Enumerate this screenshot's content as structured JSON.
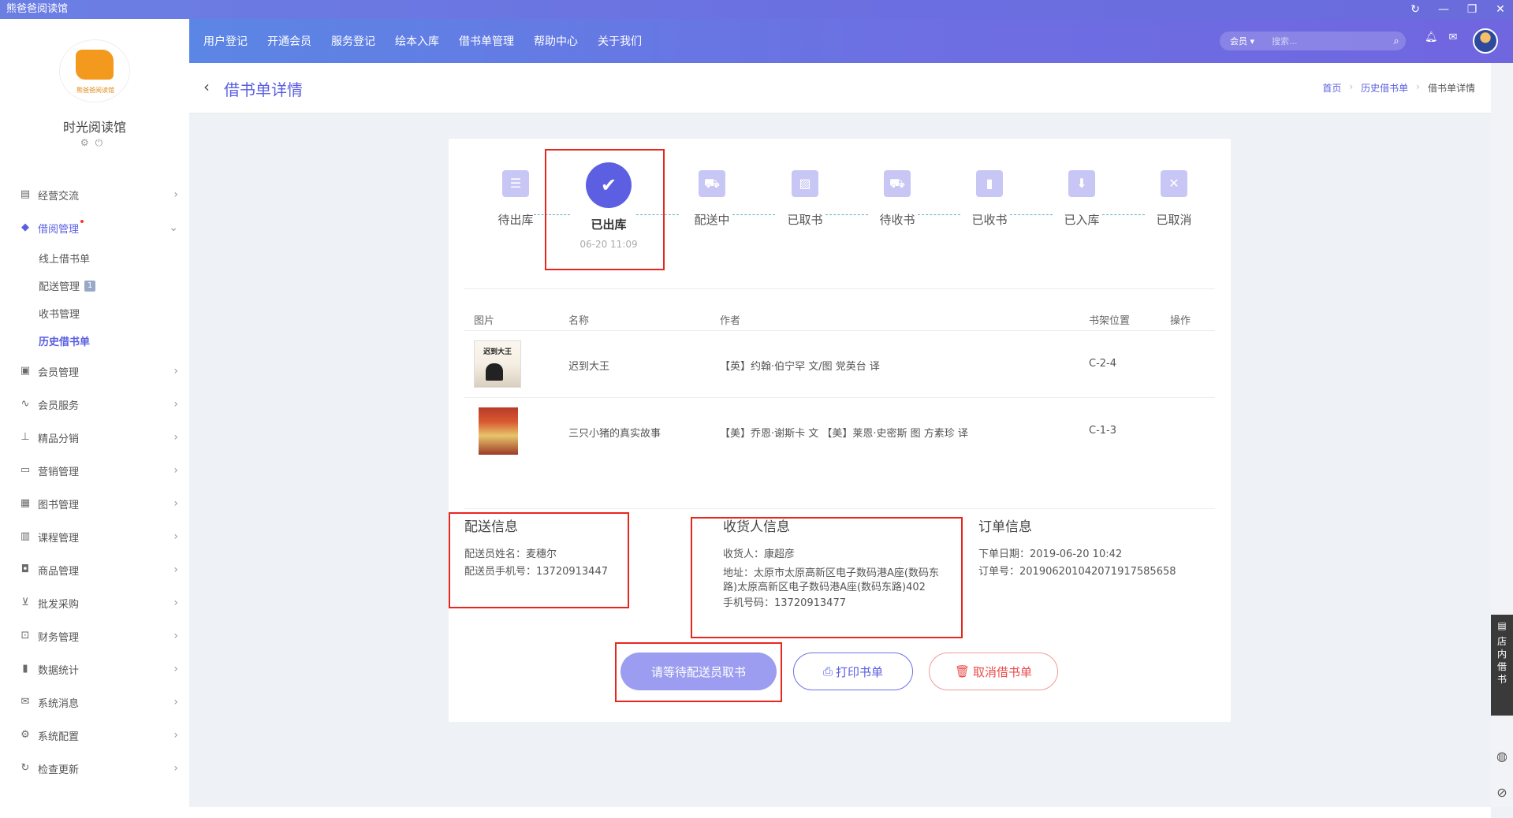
{
  "window": {
    "title": "熊爸爸阅读馆",
    "controls": [
      "↻",
      "—",
      "❐",
      "✕"
    ]
  },
  "topnav": {
    "items": [
      "用户登记",
      "开通会员",
      "服务登记",
      "绘本入库",
      "借书单管理",
      "帮助中心",
      "关于我们"
    ],
    "search_select": "会员 ▾",
    "search_placeholder": "搜索..."
  },
  "sidebar": {
    "logo_text": "熊爸爸阅读馆",
    "shop_name": "时光阅读馆",
    "menu": [
      {
        "label": "经营交流",
        "icon": "chat-icon"
      },
      {
        "label": "借阅管理",
        "icon": "book-icon"
      },
      {
        "label": "会员管理",
        "icon": "member-icon"
      },
      {
        "label": "会员服务",
        "icon": "service-icon"
      },
      {
        "label": "精品分销",
        "icon": "distribution-icon"
      },
      {
        "label": "营销管理",
        "icon": "marketing-icon"
      },
      {
        "label": "图书管理",
        "icon": "books-icon"
      },
      {
        "label": "课程管理",
        "icon": "course-icon"
      },
      {
        "label": "商品管理",
        "icon": "goods-icon"
      },
      {
        "label": "批发采购",
        "icon": "cart-icon"
      },
      {
        "label": "财务管理",
        "icon": "finance-icon"
      },
      {
        "label": "数据统计",
        "icon": "chart-icon"
      },
      {
        "label": "系统消息",
        "icon": "mail-icon"
      },
      {
        "label": "系统配置",
        "icon": "gear-icon"
      },
      {
        "label": "检查更新",
        "icon": "refresh-icon"
      }
    ],
    "submenu": [
      {
        "label": "线上借书单"
      },
      {
        "label": "配送管理",
        "badge": "1"
      },
      {
        "label": "收书管理"
      },
      {
        "label": "历史借书单"
      }
    ]
  },
  "page": {
    "title": "借书单详情",
    "breadcrumb": [
      "首页",
      "历史借书单",
      "借书单详情"
    ]
  },
  "steps": [
    {
      "label": "待出库",
      "time": ""
    },
    {
      "label": "已出库",
      "time": "06-20 11:09"
    },
    {
      "label": "配送中",
      "time": ""
    },
    {
      "label": "已取书",
      "time": ""
    },
    {
      "label": "待收书",
      "time": ""
    },
    {
      "label": "已收书",
      "time": ""
    },
    {
      "label": "已入库",
      "time": ""
    },
    {
      "label": "已取消",
      "time": ""
    }
  ],
  "table": {
    "headers": [
      "图片",
      "名称",
      "作者",
      "书架位置",
      "操作"
    ],
    "rows": [
      {
        "cover_title": "迟到大王",
        "name": "迟到大王",
        "author": "【英】约翰·伯宁罕 文/图 党英台 译",
        "shelf": "C-2-4"
      },
      {
        "cover_title": "",
        "name": "三只小猪的真实故事",
        "author": "【美】乔恩·谢斯卡 文 【美】莱恩·史密斯 图 方素珍 译",
        "shelf": "C-1-3"
      }
    ]
  },
  "delivery": {
    "title": "配送信息",
    "name_line": "配送员姓名：麦穗尔",
    "phone_line": "配送员手机号：13720913447"
  },
  "receiver": {
    "title": "收货人信息",
    "name_line": "收货人：康超彦",
    "address_line1": "地址：太原市太原高新区电子数码港A座(数码东",
    "address_line2": "路)太原高新区电子数码港A座(数码东路)402",
    "phone_line": "手机号码：13720913477"
  },
  "order": {
    "title": "订单信息",
    "date_line": "下单日期：2019-06-20 10:42",
    "no_line": "订单号：20190620104207191758565​8"
  },
  "buttons": {
    "wait": "请等待配送员取书",
    "print": "打印书单",
    "cancel": "取消借书单"
  },
  "sidetab": "店内借书"
}
